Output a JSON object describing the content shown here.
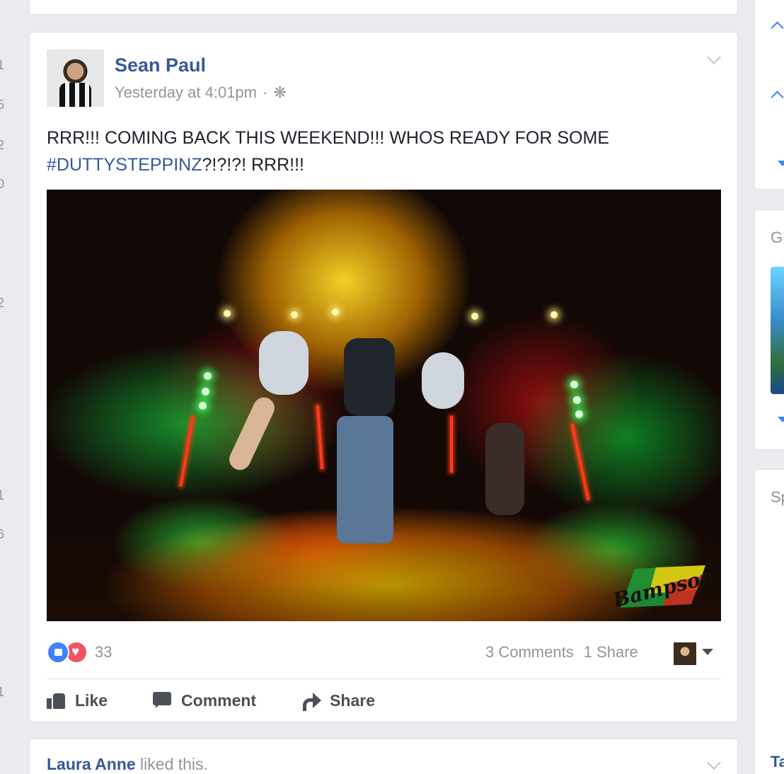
{
  "gutter": {
    "digits": [
      "1",
      "5",
      "2",
      "0",
      "2",
      "1",
      "6",
      "1"
    ]
  },
  "post": {
    "author": "Sean Paul",
    "timestamp": "Yesterday at 4:01pm",
    "separator": "·",
    "privacy_icon": "gear-icon",
    "text_before": "RRR!!! COMING BACK THIS WEEKEND!!! WHOS READY FOR SOME",
    "hashtag": "#DUTTYSTEPPINZ",
    "text_after": "?!?!?! RRR!!!",
    "photo": {
      "description_icon": "concert-photo",
      "watermark": "Bampson"
    },
    "reactions": {
      "types": [
        "like",
        "love"
      ],
      "count": "33"
    },
    "comments": "3 Comments",
    "shares": "1 Share",
    "actions": {
      "like": "Like",
      "comment": "Comment",
      "share": "Share"
    }
  },
  "next_story": {
    "actor": "Laura Anne",
    "verb": " liked this."
  },
  "right_column": {
    "card2_heading": "G",
    "card3_heading": "Sp",
    "card3_bottom": "Ta"
  },
  "colors": {
    "link": "#365899",
    "like_blue": "#4080ff",
    "love_red": "#f25268",
    "meta_gray": "#90949c",
    "bg": "#e9ebee"
  }
}
